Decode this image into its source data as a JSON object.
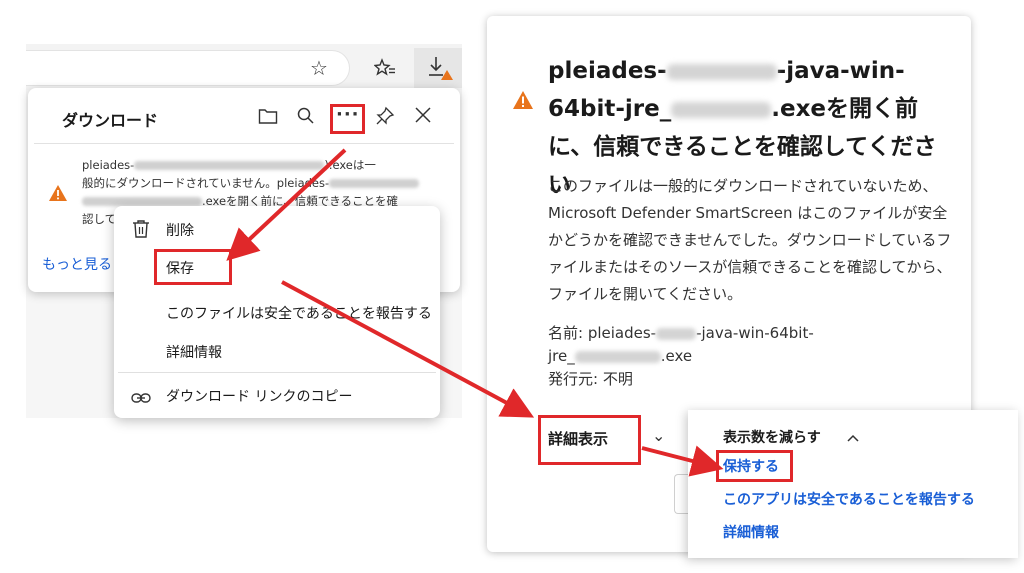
{
  "browser": {
    "toolbar_icons": [
      "star-icon",
      "favorites-icon",
      "download-icon"
    ],
    "download_panel": {
      "title": "ダウンロード",
      "header_icons": [
        "folder-icon",
        "search-icon",
        "more-icon",
        "pin-icon",
        "close-icon"
      ],
      "item": {
        "line1_prefix": "pleiades-",
        "line1_suffix": ").exeは一",
        "line2": "般的にダウンロードされていません。pleiades-",
        "line3_mid": ".exeを開く前に、信頼できることを確",
        "line4": "認してく"
      },
      "more_link": "もっと見る"
    },
    "context_menu": {
      "delete": "削除",
      "save": "保存",
      "report_safe": "このファイルは安全であることを報告する",
      "details": "詳細情報",
      "copy_link": "ダウンロード リンクのコピー"
    }
  },
  "dialog": {
    "title_part1": "pleiades-",
    "title_part2": "-java-win-",
    "title_part3": "64bit-jre_",
    "title_part4": ".exeを開く前",
    "title_part5": "に、信頼できることを確認してください",
    "body": "このファイルは一般的にダウンロードされていないため、Microsoft Defender SmartScreen はこのファイルが安全かどうかを確認できませんでした。ダウンロードしているファイルまたはそのソースが信頼できることを確認してから、ファイルを開いてください。",
    "name_label_prefix": "名前: pleiades-",
    "name_label_mid": "-java-win-64bit-",
    "name_line2_prefix": "jre_",
    "name_line2_suffix": ".exe",
    "publisher": "発行元: 不明",
    "details_button": "詳細表示",
    "details_chevron": "⌄",
    "sub_panel": {
      "title": "表示数を減らす",
      "chevron": "^",
      "keep": "保持する",
      "report_safe": "このアプリは安全であることを報告する",
      "details": "詳細情報"
    }
  },
  "colors": {
    "annotation_red": "#e0282a",
    "link_blue": "#1a5fd6",
    "warning_orange": "#e8741c"
  }
}
